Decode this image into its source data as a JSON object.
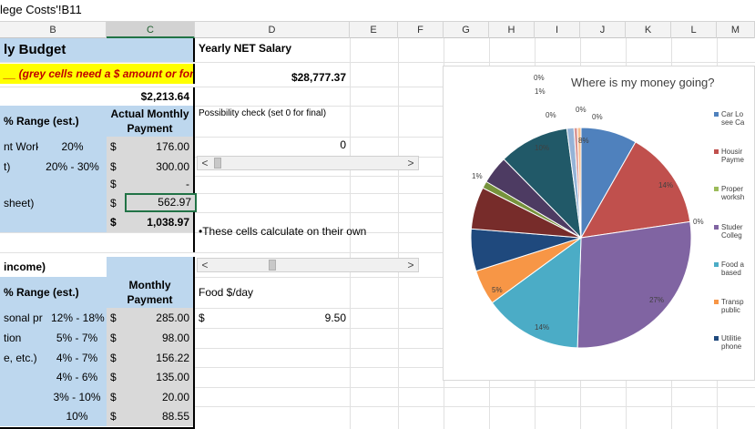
{
  "formula_bar": {
    "reference": "lege Costs'!B11"
  },
  "columns": [
    "B",
    "C",
    "D",
    "E",
    "F",
    "G",
    "H",
    "I",
    "J",
    "K",
    "L",
    "M"
  ],
  "left_table": {
    "title": "ly Budget",
    "instruction": "__ (grey cells need a $ amount or forr",
    "top_total": "$2,213.64",
    "header1": {
      "range": "% Range (est.)",
      "payment_line1": "Actual Monthly",
      "payment_line2": "Payment"
    },
    "rows1": [
      {
        "label": "nt Work",
        "range": "20%",
        "currency": "$",
        "amount": "176.00"
      },
      {
        "label": "t)",
        "range": "20% - 30%",
        "currency": "$",
        "amount": "300.00"
      },
      {
        "label": "",
        "range": "",
        "currency": "$",
        "amount": "-"
      },
      {
        "label": "sheet)",
        "range": "",
        "currency": "$",
        "amount": "562.97"
      }
    ],
    "total_row": {
      "currency": "$",
      "amount": "1,038.97"
    },
    "section2_title": "income)",
    "header2": {
      "range": "% Range (est.)",
      "payment_line1": "Monthly",
      "payment_line2": "Payment"
    },
    "rows2": [
      {
        "label": "sonal pr",
        "range": "12% - 18%",
        "currency": "$",
        "amount": "285.00"
      },
      {
        "label": "tion",
        "range": "5% - 7%",
        "currency": "$",
        "amount": "98.00"
      },
      {
        "label": "e, etc.)",
        "range": "4% - 7%",
        "currency": "$",
        "amount": "156.22"
      },
      {
        "label": "",
        "range": "4% - 6%",
        "currency": "$",
        "amount": "135.00"
      },
      {
        "label": "",
        "range": "3% - 10%",
        "currency": "$",
        "amount": "20.00"
      },
      {
        "label": "",
        "range": "10%",
        "currency": "$",
        "amount": "88.55"
      }
    ]
  },
  "column_d": {
    "salary_label": "Yearly NET Salary",
    "salary_value": "$28,777.37",
    "possibility_label": "Possibility check (set 0 for final)",
    "possibility_value": "0",
    "auto_note": "•These cells calculate on their own",
    "food_label": "Food $/day",
    "food_currency": "$",
    "food_value": "9.50"
  },
  "scroll_arrows": {
    "left": "<",
    "right": ">"
  },
  "chart_data": {
    "type": "pie",
    "title": "Where is my money going?",
    "labels_printed": [
      "0%",
      "1%",
      "0%",
      "0%",
      "0%",
      "8%",
      "14%",
      "0%",
      "27%",
      "14%",
      "5%",
      "1%",
      "10%"
    ],
    "slices": [
      {
        "name": "Car Lo... see Ca...",
        "percent": 8,
        "color": "#4f81bd"
      },
      {
        "name": "Housi... Payme...",
        "percent": 14,
        "color": "#c0504d"
      },
      {
        "name": "Proper... worksh...",
        "percent": 0,
        "color": "#9bbb59"
      },
      {
        "name": "Studen... Colleg...",
        "percent": 27,
        "color": "#8064a2"
      },
      {
        "name": "Food a... based...",
        "percent": 14,
        "color": "#4bacc6"
      },
      {
        "name": "Transp... public...",
        "percent": 5,
        "color": "#f79646"
      },
      {
        "name": "Utilitie... phone...",
        "percent": 6,
        "color": "#1f497d"
      },
      {
        "name": "",
        "percent": 6,
        "color": "#772c2a"
      },
      {
        "name": "",
        "percent": 1,
        "color": "#77933c"
      },
      {
        "name": "",
        "percent": 4,
        "color": "#4d3b62"
      },
      {
        "name": "",
        "percent": 10,
        "color": "#215968"
      },
      {
        "name": "",
        "percent": 1,
        "color": "#95b3d7"
      },
      {
        "name": "",
        "percent": 0.5,
        "color": "#d99694"
      },
      {
        "name": "",
        "percent": 0.5,
        "color": "#fac08f"
      }
    ],
    "legend": [
      {
        "line1": "Car Lo",
        "line2": "see Ca",
        "color": "#4f81bd"
      },
      {
        "line1": "Housir",
        "line2": "Payme",
        "color": "#c0504d"
      },
      {
        "line1": "Proper",
        "line2": "worksh",
        "color": "#9bbb59"
      },
      {
        "line1": "Studer",
        "line2": "Colleg",
        "color": "#8064a2"
      },
      {
        "line1": "Food a",
        "line2": "based",
        "color": "#4bacc6"
      },
      {
        "line1": "Transp",
        "line2": "public",
        "color": "#f79646"
      },
      {
        "line1": "Utilitie",
        "line2": "phone",
        "color": "#1f497d"
      }
    ]
  }
}
